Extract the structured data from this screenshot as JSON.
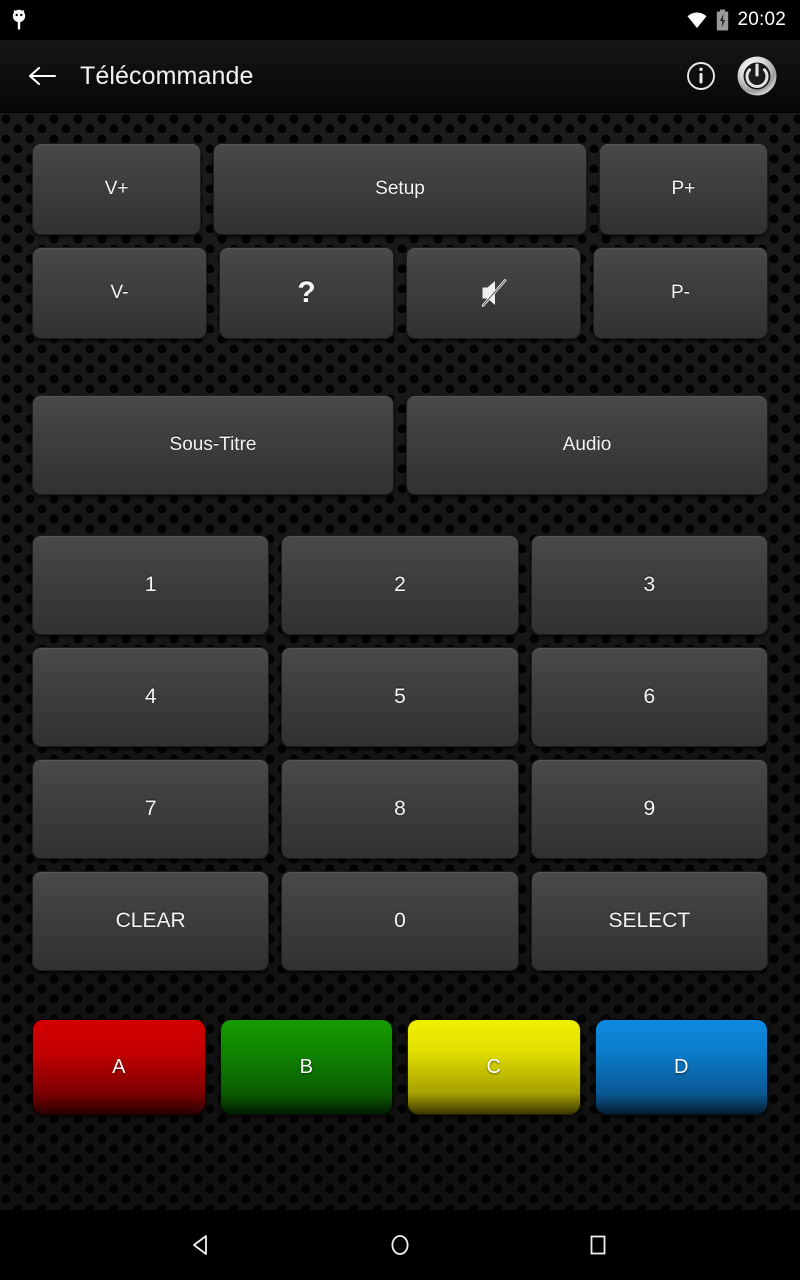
{
  "status_bar": {
    "time": "20:02",
    "icons": [
      "android-debug-icon",
      "wifi-icon",
      "battery-charging-icon"
    ]
  },
  "action_bar": {
    "back_label": "back-arrow-icon",
    "title": "Télécommande",
    "info_label": "info-icon",
    "power_label": "power-icon"
  },
  "remote": {
    "row1": [
      {
        "id": "volume-up",
        "label": "V+",
        "type": "text",
        "span": 1
      },
      {
        "id": "setup",
        "label": "Setup",
        "type": "text",
        "span": 2
      },
      {
        "id": "program-up",
        "label": "P+",
        "type": "text",
        "span": 1
      }
    ],
    "row2": [
      {
        "id": "volume-down",
        "label": "V-",
        "type": "text",
        "span": 1
      },
      {
        "id": "help",
        "label": "?",
        "type": "text",
        "span": 1
      },
      {
        "id": "mute",
        "label": "",
        "type": "icon",
        "icon": "mute-icon",
        "span": 1
      },
      {
        "id": "program-down",
        "label": "P-",
        "type": "text",
        "span": 1
      }
    ],
    "row3": [
      {
        "id": "subtitle",
        "label": "Sous-Titre",
        "type": "text"
      },
      {
        "id": "audio",
        "label": "Audio",
        "type": "text"
      }
    ],
    "keypad": [
      [
        {
          "id": "key-1",
          "label": "1"
        },
        {
          "id": "key-2",
          "label": "2"
        },
        {
          "id": "key-3",
          "label": "3"
        }
      ],
      [
        {
          "id": "key-4",
          "label": "4"
        },
        {
          "id": "key-5",
          "label": "5"
        },
        {
          "id": "key-6",
          "label": "6"
        }
      ],
      [
        {
          "id": "key-7",
          "label": "7"
        },
        {
          "id": "key-8",
          "label": "8"
        },
        {
          "id": "key-9",
          "label": "9"
        }
      ],
      [
        {
          "id": "clear",
          "label": "CLEAR"
        },
        {
          "id": "key-0",
          "label": "0"
        },
        {
          "id": "select",
          "label": "SELECT"
        }
      ]
    ],
    "color_keys": [
      {
        "id": "color-a",
        "label": "A",
        "color": "#c10000"
      },
      {
        "id": "color-b",
        "label": "B",
        "color": "#0f8400"
      },
      {
        "id": "color-c",
        "label": "C",
        "color": "#e3e000"
      },
      {
        "id": "color-d",
        "label": "D",
        "color": "#0b7ccb"
      }
    ]
  },
  "nav_bar": {
    "back": "back-triangle-icon",
    "home": "home-circle-icon",
    "recents": "recents-square-icon"
  }
}
